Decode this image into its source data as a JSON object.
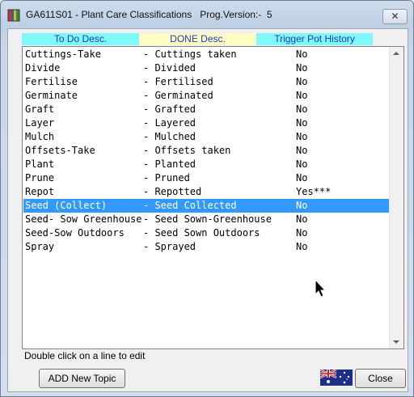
{
  "window": {
    "title": "GA611S01 - Plant Care Classifications   Prog.Version:-  5",
    "close_glyph": "✕"
  },
  "columns": [
    "To Do Desc.",
    "DONE Desc.",
    "Trigger Pot History"
  ],
  "rows": [
    {
      "todo": "Cuttings-Take",
      "done": "- Cuttings taken",
      "trigger": "No"
    },
    {
      "todo": "Divide",
      "done": "- Divided",
      "trigger": "No"
    },
    {
      "todo": "Fertilise",
      "done": "- Fertilised",
      "trigger": "No"
    },
    {
      "todo": "Germinate",
      "done": "- Germinated",
      "trigger": "No"
    },
    {
      "todo": "Graft",
      "done": "- Grafted",
      "trigger": "No"
    },
    {
      "todo": "Layer",
      "done": "- Layered",
      "trigger": "No"
    },
    {
      "todo": "Mulch",
      "done": "- Mulched",
      "trigger": "No"
    },
    {
      "todo": "Offsets-Take",
      "done": "- Offsets taken",
      "trigger": "No"
    },
    {
      "todo": "Plant",
      "done": "- Planted",
      "trigger": "No"
    },
    {
      "todo": "Prune",
      "done": "- Pruned",
      "trigger": "No"
    },
    {
      "todo": "Repot",
      "done": "- Repotted",
      "trigger": "Yes***"
    },
    {
      "todo": "Seed (Collect)",
      "done": "- Seed Collected",
      "trigger": "No",
      "selected": true
    },
    {
      "todo": "Seed- Sow Greenhouse",
      "done": "- Seed Sown-Greenhouse",
      "trigger": "No"
    },
    {
      "todo": "Seed-Sow Outdoors",
      "done": "- Seed Sown Outdoors",
      "trigger": "No"
    },
    {
      "todo": "Spray",
      "done": "- Sprayed",
      "trigger": "No"
    }
  ],
  "hint": "Double click on a line to edit",
  "buttons": {
    "add": "ADD New Topic",
    "close": "Close"
  },
  "icons": {
    "app": "app-icon",
    "flag": "australian-flag-icon",
    "cursor": "mouse-pointer-icon"
  },
  "colors": {
    "selection": "#3399ff",
    "header_cyan": "#7ff8ff",
    "header_yellow": "#ffffc4",
    "header_text": "#1a3cc8"
  }
}
